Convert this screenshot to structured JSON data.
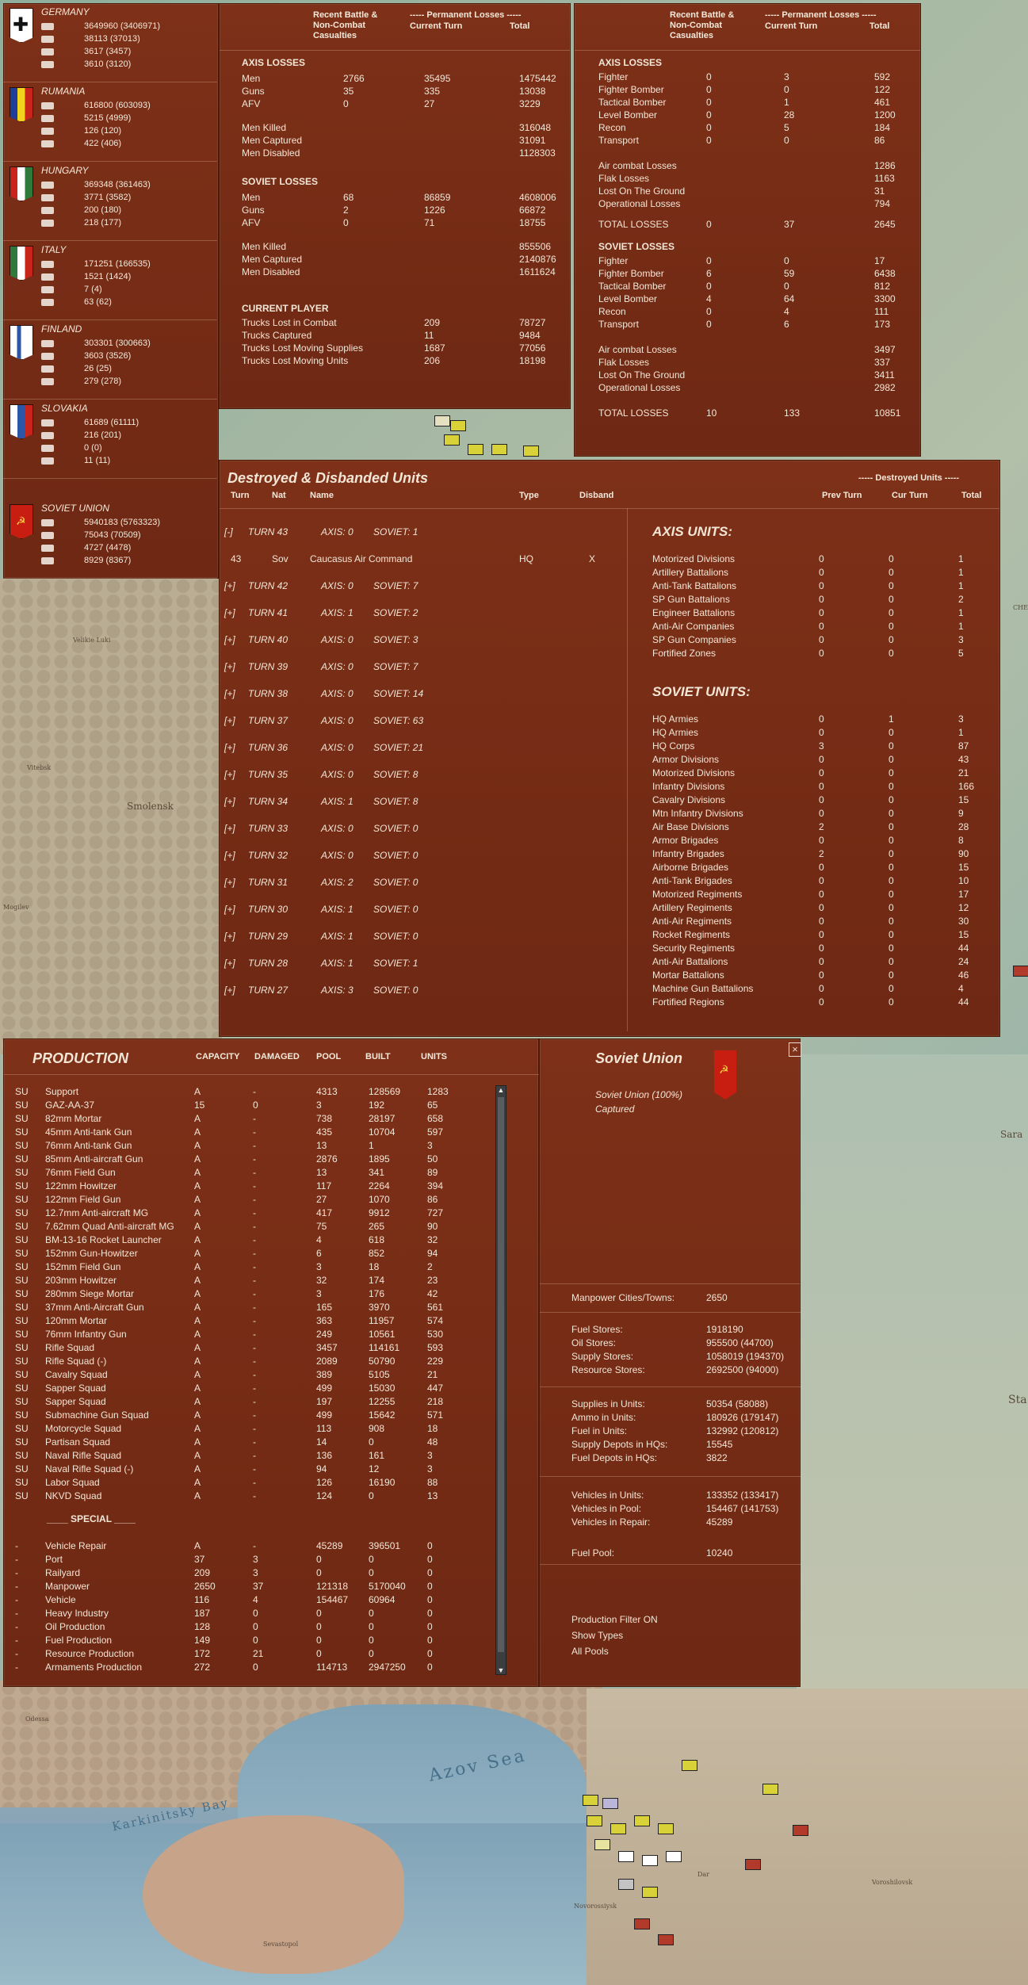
{
  "map": {
    "labels": {
      "smolensk": "Smolensk",
      "vyazma": "Velikie Luki",
      "vitebsk": "Vitebsk",
      "mogilev": "Mogilev",
      "azov": "Azov Sea",
      "karkinitsky": "Karkinitsky Bay",
      "odessa": "Odessa",
      "sevastopol": "Sevastopol",
      "novorossiysk": "Novorossiysk",
      "krasnodar": "Dar",
      "voroshilovsk": "Voroshilovsk",
      "sta": "Sta",
      "sara": "Sara",
      "che": "CHE"
    }
  },
  "nations": [
    {
      "name": "GERMANY",
      "men": "3649960 (3406971)",
      "guns": "38113 (37013)",
      "afv": "3617 (3457)",
      "air": "3610 (3120)",
      "flag": "germany"
    },
    {
      "name": "RUMANIA",
      "men": "616800 (603093)",
      "guns": "5215 (4999)",
      "afv": "126 (120)",
      "air": "422 (406)",
      "flag": "rumania"
    },
    {
      "name": "HUNGARY",
      "men": "369348 (361463)",
      "guns": "3771 (3582)",
      "afv": "200 (180)",
      "air": "218 (177)",
      "flag": "hungary"
    },
    {
      "name": "ITALY",
      "men": "171251 (166535)",
      "guns": "1521 (1424)",
      "afv": "7 (4)",
      "air": "63 (62)",
      "flag": "italy"
    },
    {
      "name": "FINLAND",
      "men": "303301 (300663)",
      "guns": "3603 (3526)",
      "afv": "26 (25)",
      "air": "279 (278)",
      "flag": "finland"
    },
    {
      "name": "SLOVAKIA",
      "men": "61689 (61111)",
      "guns": "216 (201)",
      "afv": "0 (0)",
      "air": "11 (11)",
      "flag": "slovakia"
    },
    {
      "name": "SOVIET UNION",
      "men": "5940183 (5763323)",
      "guns": "75043 (70509)",
      "afv": "4727 (4478)",
      "air": "8929 (8367)",
      "flag": "soviet"
    }
  ],
  "ground_losses": {
    "headers": {
      "col1": "Recent Battle & Non-Combat Casualties",
      "col2": "----- Permanent Losses -----",
      "col3": "Current Turn",
      "col4": "Total"
    },
    "axis_title": "AXIS LOSSES",
    "axis_rows": [
      [
        "Men",
        "2766",
        "35495",
        "1475442"
      ],
      [
        "Guns",
        "35",
        "335",
        "13038"
      ],
      [
        "AFV",
        "0",
        "27",
        "3229"
      ]
    ],
    "axis_sub": [
      [
        "Men Killed",
        "316048"
      ],
      [
        "Men Captured",
        "31091"
      ],
      [
        "Men Disabled",
        "1128303"
      ]
    ],
    "soviet_title": "SOVIET LOSSES",
    "soviet_rows": [
      [
        "Men",
        "68",
        "86859",
        "4608006"
      ],
      [
        "Guns",
        "2",
        "1226",
        "66872"
      ],
      [
        "AFV",
        "0",
        "71",
        "18755"
      ]
    ],
    "soviet_sub": [
      [
        "Men Killed",
        "855506"
      ],
      [
        "Men Captured",
        "2140876"
      ],
      [
        "Men Disabled",
        "1611624"
      ]
    ],
    "cp_title": "CURRENT PLAYER",
    "cp_rows": [
      [
        "Trucks Lost in Combat",
        "209",
        "78727"
      ],
      [
        "Trucks Captured",
        "11",
        "9484"
      ],
      [
        "Trucks Lost Moving Supplies",
        "1687",
        "77056"
      ],
      [
        "Trucks Lost Moving Units",
        "206",
        "18198"
      ]
    ]
  },
  "air_losses": {
    "headers": {
      "col1": "Recent Battle & Non-Combat Casualties",
      "col2": "----- Permanent Losses -----",
      "col3": "Current Turn",
      "col4": "Total"
    },
    "axis_title": "AXIS LOSSES",
    "axis_rows": [
      [
        "Fighter",
        "0",
        "3",
        "592"
      ],
      [
        "Fighter Bomber",
        "0",
        "0",
        "122"
      ],
      [
        "Tactical Bomber",
        "0",
        "1",
        "461"
      ],
      [
        "Level Bomber",
        "0",
        "28",
        "1200"
      ],
      [
        "Recon",
        "0",
        "5",
        "184"
      ],
      [
        "Transport",
        "0",
        "0",
        "86"
      ]
    ],
    "axis_sub": [
      [
        "Air combat Losses",
        "1286"
      ],
      [
        "Flak Losses",
        "1163"
      ],
      [
        "Lost On The Ground",
        "31"
      ],
      [
        "Operational Losses",
        "794"
      ]
    ],
    "axis_total": [
      "TOTAL LOSSES",
      "0",
      "37",
      "2645"
    ],
    "soviet_title": "SOVIET LOSSES",
    "soviet_rows": [
      [
        "Fighter",
        "0",
        "0",
        "17"
      ],
      [
        "Fighter Bomber",
        "6",
        "59",
        "6438"
      ],
      [
        "Tactical Bomber",
        "0",
        "0",
        "812"
      ],
      [
        "Level Bomber",
        "4",
        "64",
        "3300"
      ],
      [
        "Recon",
        "0",
        "4",
        "111"
      ],
      [
        "Transport",
        "0",
        "6",
        "173"
      ]
    ],
    "soviet_sub": [
      [
        "Air combat Losses",
        "3497"
      ],
      [
        "Flak Losses",
        "337"
      ],
      [
        "Lost On The Ground",
        "3411"
      ],
      [
        "Operational Losses",
        "2982"
      ]
    ],
    "soviet_total": [
      "TOTAL LOSSES",
      "10",
      "133",
      "10851"
    ]
  },
  "destroyed": {
    "title": "Destroyed & Disbanded Units",
    "headers": [
      "Turn",
      "Nat",
      "Name",
      "Type",
      "Disband"
    ],
    "right_header": "----- Destroyed Units -----",
    "right_cols": [
      "Prev Turn",
      "Cur Turn",
      "Total"
    ],
    "turns": [
      {
        "tog": "[-]",
        "turn": "TURN 43",
        "axis": "AXIS: 0",
        "sov": "SOVIET: 1"
      },
      {
        "detail": true,
        "turn": "43",
        "nat": "Sov",
        "name": "Caucasus Air Command",
        "type": "HQ",
        "dis": "X"
      },
      {
        "tog": "[+]",
        "turn": "TURN 42",
        "axis": "AXIS: 0",
        "sov": "SOVIET: 7"
      },
      {
        "tog": "[+]",
        "turn": "TURN 41",
        "axis": "AXIS: 1",
        "sov": "SOVIET: 2"
      },
      {
        "tog": "[+]",
        "turn": "TURN 40",
        "axis": "AXIS: 0",
        "sov": "SOVIET: 3"
      },
      {
        "tog": "[+]",
        "turn": "TURN 39",
        "axis": "AXIS: 0",
        "sov": "SOVIET: 7"
      },
      {
        "tog": "[+]",
        "turn": "TURN 38",
        "axis": "AXIS: 0",
        "sov": "SOVIET: 14"
      },
      {
        "tog": "[+]",
        "turn": "TURN 37",
        "axis": "AXIS: 0",
        "sov": "SOVIET: 63"
      },
      {
        "tog": "[+]",
        "turn": "TURN 36",
        "axis": "AXIS: 0",
        "sov": "SOVIET: 21"
      },
      {
        "tog": "[+]",
        "turn": "TURN 35",
        "axis": "AXIS: 0",
        "sov": "SOVIET: 8"
      },
      {
        "tog": "[+]",
        "turn": "TURN 34",
        "axis": "AXIS: 1",
        "sov": "SOVIET: 8"
      },
      {
        "tog": "[+]",
        "turn": "TURN 33",
        "axis": "AXIS: 0",
        "sov": "SOVIET: 0"
      },
      {
        "tog": "[+]",
        "turn": "TURN 32",
        "axis": "AXIS: 0",
        "sov": "SOVIET: 0"
      },
      {
        "tog": "[+]",
        "turn": "TURN 31",
        "axis": "AXIS: 2",
        "sov": "SOVIET: 0"
      },
      {
        "tog": "[+]",
        "turn": "TURN 30",
        "axis": "AXIS: 1",
        "sov": "SOVIET: 0"
      },
      {
        "tog": "[+]",
        "turn": "TURN 29",
        "axis": "AXIS: 1",
        "sov": "SOVIET: 0"
      },
      {
        "tog": "[+]",
        "turn": "TURN 28",
        "axis": "AXIS: 1",
        "sov": "SOVIET: 1"
      },
      {
        "tog": "[+]",
        "turn": "TURN 27",
        "axis": "AXIS: 3",
        "sov": "SOVIET: 0"
      }
    ],
    "axis_title": "AXIS UNITS:",
    "axis_units": [
      [
        "Motorized Divisions",
        "0",
        "0",
        "1"
      ],
      [
        "Artillery Battalions",
        "0",
        "0",
        "1"
      ],
      [
        "Anti-Tank Battalions",
        "0",
        "0",
        "1"
      ],
      [
        "SP Gun Battalions",
        "0",
        "0",
        "2"
      ],
      [
        "Engineer Battalions",
        "0",
        "0",
        "1"
      ],
      [
        "Anti-Air Companies",
        "0",
        "0",
        "1"
      ],
      [
        "SP Gun Companies",
        "0",
        "0",
        "3"
      ],
      [
        "Fortified Zones",
        "0",
        "0",
        "5"
      ]
    ],
    "soviet_title": "SOVIET UNITS:",
    "soviet_units": [
      [
        "HQ Armies",
        "0",
        "1",
        "3"
      ],
      [
        "HQ Armies",
        "0",
        "0",
        "1"
      ],
      [
        "HQ Corps",
        "3",
        "0",
        "87"
      ],
      [
        "Armor Divisions",
        "0",
        "0",
        "43"
      ],
      [
        "Motorized Divisions",
        "0",
        "0",
        "21"
      ],
      [
        "Infantry Divisions",
        "0",
        "0",
        "166"
      ],
      [
        "Cavalry Divisions",
        "0",
        "0",
        "15"
      ],
      [
        "Mtn Infantry Divisions",
        "0",
        "0",
        "9"
      ],
      [
        "Air Base Divisions",
        "2",
        "0",
        "28"
      ],
      [
        "Armor Brigades",
        "0",
        "0",
        "8"
      ],
      [
        "Infantry Brigades",
        "2",
        "0",
        "90"
      ],
      [
        "Airborne Brigades",
        "0",
        "0",
        "15"
      ],
      [
        "Anti-Tank Brigades",
        "0",
        "0",
        "10"
      ],
      [
        "Motorized Regiments",
        "0",
        "0",
        "17"
      ],
      [
        "Artillery Regiments",
        "0",
        "0",
        "12"
      ],
      [
        "Anti-Air Regiments",
        "0",
        "0",
        "30"
      ],
      [
        "Rocket Regiments",
        "0",
        "0",
        "15"
      ],
      [
        "Security Regiments",
        "0",
        "0",
        "44"
      ],
      [
        "Anti-Air Battalions",
        "0",
        "0",
        "24"
      ],
      [
        "Mortar Battalions",
        "0",
        "0",
        "46"
      ],
      [
        "Machine Gun Battalions",
        "0",
        "0",
        "4"
      ],
      [
        "Fortified Regions",
        "0",
        "0",
        "44"
      ]
    ]
  },
  "production": {
    "title": "PRODUCTION",
    "headers": [
      "CAPACITY",
      "DAMAGED",
      "POOL",
      "BUILT",
      "UNITS"
    ],
    "rows": [
      [
        "SU",
        "Support",
        "A",
        "-",
        "4313",
        "128569",
        "1283"
      ],
      [
        "SU",
        "GAZ-AA-37",
        "15",
        "0",
        "3",
        "192",
        "65"
      ],
      [
        "SU",
        "82mm Mortar",
        "A",
        "-",
        "738",
        "28197",
        "658"
      ],
      [
        "SU",
        "45mm Anti-tank Gun",
        "A",
        "-",
        "435",
        "10704",
        "597"
      ],
      [
        "SU",
        "76mm Anti-tank Gun",
        "A",
        "-",
        "13",
        "1",
        "3"
      ],
      [
        "SU",
        "85mm Anti-aircraft Gun",
        "A",
        "-",
        "2876",
        "1895",
        "50"
      ],
      [
        "SU",
        "76mm Field Gun",
        "A",
        "-",
        "13",
        "341",
        "89"
      ],
      [
        "SU",
        "122mm Howitzer",
        "A",
        "-",
        "117",
        "2264",
        "394"
      ],
      [
        "SU",
        "122mm Field Gun",
        "A",
        "-",
        "27",
        "1070",
        "86"
      ],
      [
        "SU",
        "12.7mm Anti-aircraft MG",
        "A",
        "-",
        "417",
        "9912",
        "727"
      ],
      [
        "SU",
        "7.62mm Quad Anti-aircraft MG",
        "A",
        "-",
        "75",
        "265",
        "90"
      ],
      [
        "SU",
        "BM-13-16 Rocket Launcher",
        "A",
        "-",
        "4",
        "618",
        "32"
      ],
      [
        "SU",
        "152mm Gun-Howitzer",
        "A",
        "-",
        "6",
        "852",
        "94"
      ],
      [
        "SU",
        "152mm Field Gun",
        "A",
        "-",
        "3",
        "18",
        "2"
      ],
      [
        "SU",
        "203mm Howitzer",
        "A",
        "-",
        "32",
        "174",
        "23"
      ],
      [
        "SU",
        "280mm Siege Mortar",
        "A",
        "-",
        "3",
        "176",
        "42"
      ],
      [
        "SU",
        "37mm Anti-Aircraft Gun",
        "A",
        "-",
        "165",
        "3970",
        "561"
      ],
      [
        "SU",
        "120mm Mortar",
        "A",
        "-",
        "363",
        "11957",
        "574"
      ],
      [
        "SU",
        "76mm Infantry Gun",
        "A",
        "-",
        "249",
        "10561",
        "530"
      ],
      [
        "SU",
        "Rifle Squad",
        "A",
        "-",
        "3457",
        "114161",
        "593"
      ],
      [
        "SU",
        "Rifle Squad (-)",
        "A",
        "-",
        "2089",
        "50790",
        "229"
      ],
      [
        "SU",
        "Cavalry Squad",
        "A",
        "-",
        "389",
        "5105",
        "21"
      ],
      [
        "SU",
        "Sapper Squad",
        "A",
        "-",
        "499",
        "15030",
        "447"
      ],
      [
        "SU",
        "Sapper Squad",
        "A",
        "-",
        "197",
        "12255",
        "218"
      ],
      [
        "SU",
        "Submachine Gun Squad",
        "A",
        "-",
        "499",
        "15642",
        "571"
      ],
      [
        "SU",
        "Motorcycle Squad",
        "A",
        "-",
        "113",
        "908",
        "18"
      ],
      [
        "SU",
        "Partisan Squad",
        "A",
        "-",
        "14",
        "0",
        "48"
      ],
      [
        "SU",
        "Naval Rifle Squad",
        "A",
        "-",
        "136",
        "161",
        "3"
      ],
      [
        "SU",
        "Naval Rifle Squad (-)",
        "A",
        "-",
        "94",
        "12",
        "3"
      ],
      [
        "SU",
        "Labor Squad",
        "A",
        "-",
        "126",
        "16190",
        "88"
      ],
      [
        "SU",
        "NKVD Squad",
        "A",
        "-",
        "124",
        "0",
        "13"
      ]
    ],
    "special_title": "____ SPECIAL ____",
    "special_rows": [
      [
        "-",
        "Vehicle Repair",
        "A",
        "-",
        "45289",
        "396501",
        "0"
      ],
      [
        "-",
        "Port",
        "37",
        "3",
        "0",
        "0",
        "0"
      ],
      [
        "-",
        "Railyard",
        "209",
        "3",
        "0",
        "0",
        "0"
      ],
      [
        "-",
        "Manpower",
        "2650",
        "37",
        "121318",
        "5170040",
        "0"
      ],
      [
        "-",
        "Vehicle",
        "116",
        "4",
        "154467",
        "60964",
        "0"
      ],
      [
        "-",
        "Heavy Industry",
        "187",
        "0",
        "0",
        "0",
        "0"
      ],
      [
        "-",
        "Oil Production",
        "128",
        "0",
        "0",
        "0",
        "0"
      ],
      [
        "-",
        "Fuel Production",
        "149",
        "0",
        "0",
        "0",
        "0"
      ],
      [
        "-",
        "Resource Production",
        "172",
        "21",
        "0",
        "0",
        "0"
      ],
      [
        "-",
        "Armaments Production",
        "272",
        "0",
        "114713",
        "2947250",
        "0"
      ]
    ]
  },
  "summary": {
    "title": "Soviet Union",
    "line1": "Soviet Union  (100%)",
    "line2": "Captured",
    "close": "×",
    "manpower": [
      "Manpower Cities/Towns:",
      "2650"
    ],
    "stores": [
      [
        "Fuel Stores:",
        "1918190"
      ],
      [
        "Oil Stores:",
        "955500 (44700)"
      ],
      [
        "Supply Stores:",
        "1058019 (194370)"
      ],
      [
        "Resource Stores:",
        "2692500 (94000)"
      ]
    ],
    "units": [
      [
        "Supplies in Units:",
        "50354 (58088)"
      ],
      [
        "Ammo in Units:",
        "180926 (179147)"
      ],
      [
        "Fuel in Units:",
        "132992 (120812)"
      ],
      [
        "Supply Depots in HQs:",
        "15545"
      ],
      [
        "Fuel Depots in HQs:",
        "3822"
      ]
    ],
    "vehicles": [
      [
        "Vehicles in Units:",
        "133352 (133417)"
      ],
      [
        "Vehicles in Pool:",
        "154467 (141753)"
      ],
      [
        "Vehicles in Repair:",
        "45289"
      ]
    ],
    "fuelpool": [
      "Fuel Pool:",
      "10240"
    ],
    "filters": [
      "Production Filter ON",
      "Show Types",
      "All Pools"
    ]
  },
  "colors": {
    "panel": "#7a2e16",
    "text": "#f2e6d6"
  }
}
